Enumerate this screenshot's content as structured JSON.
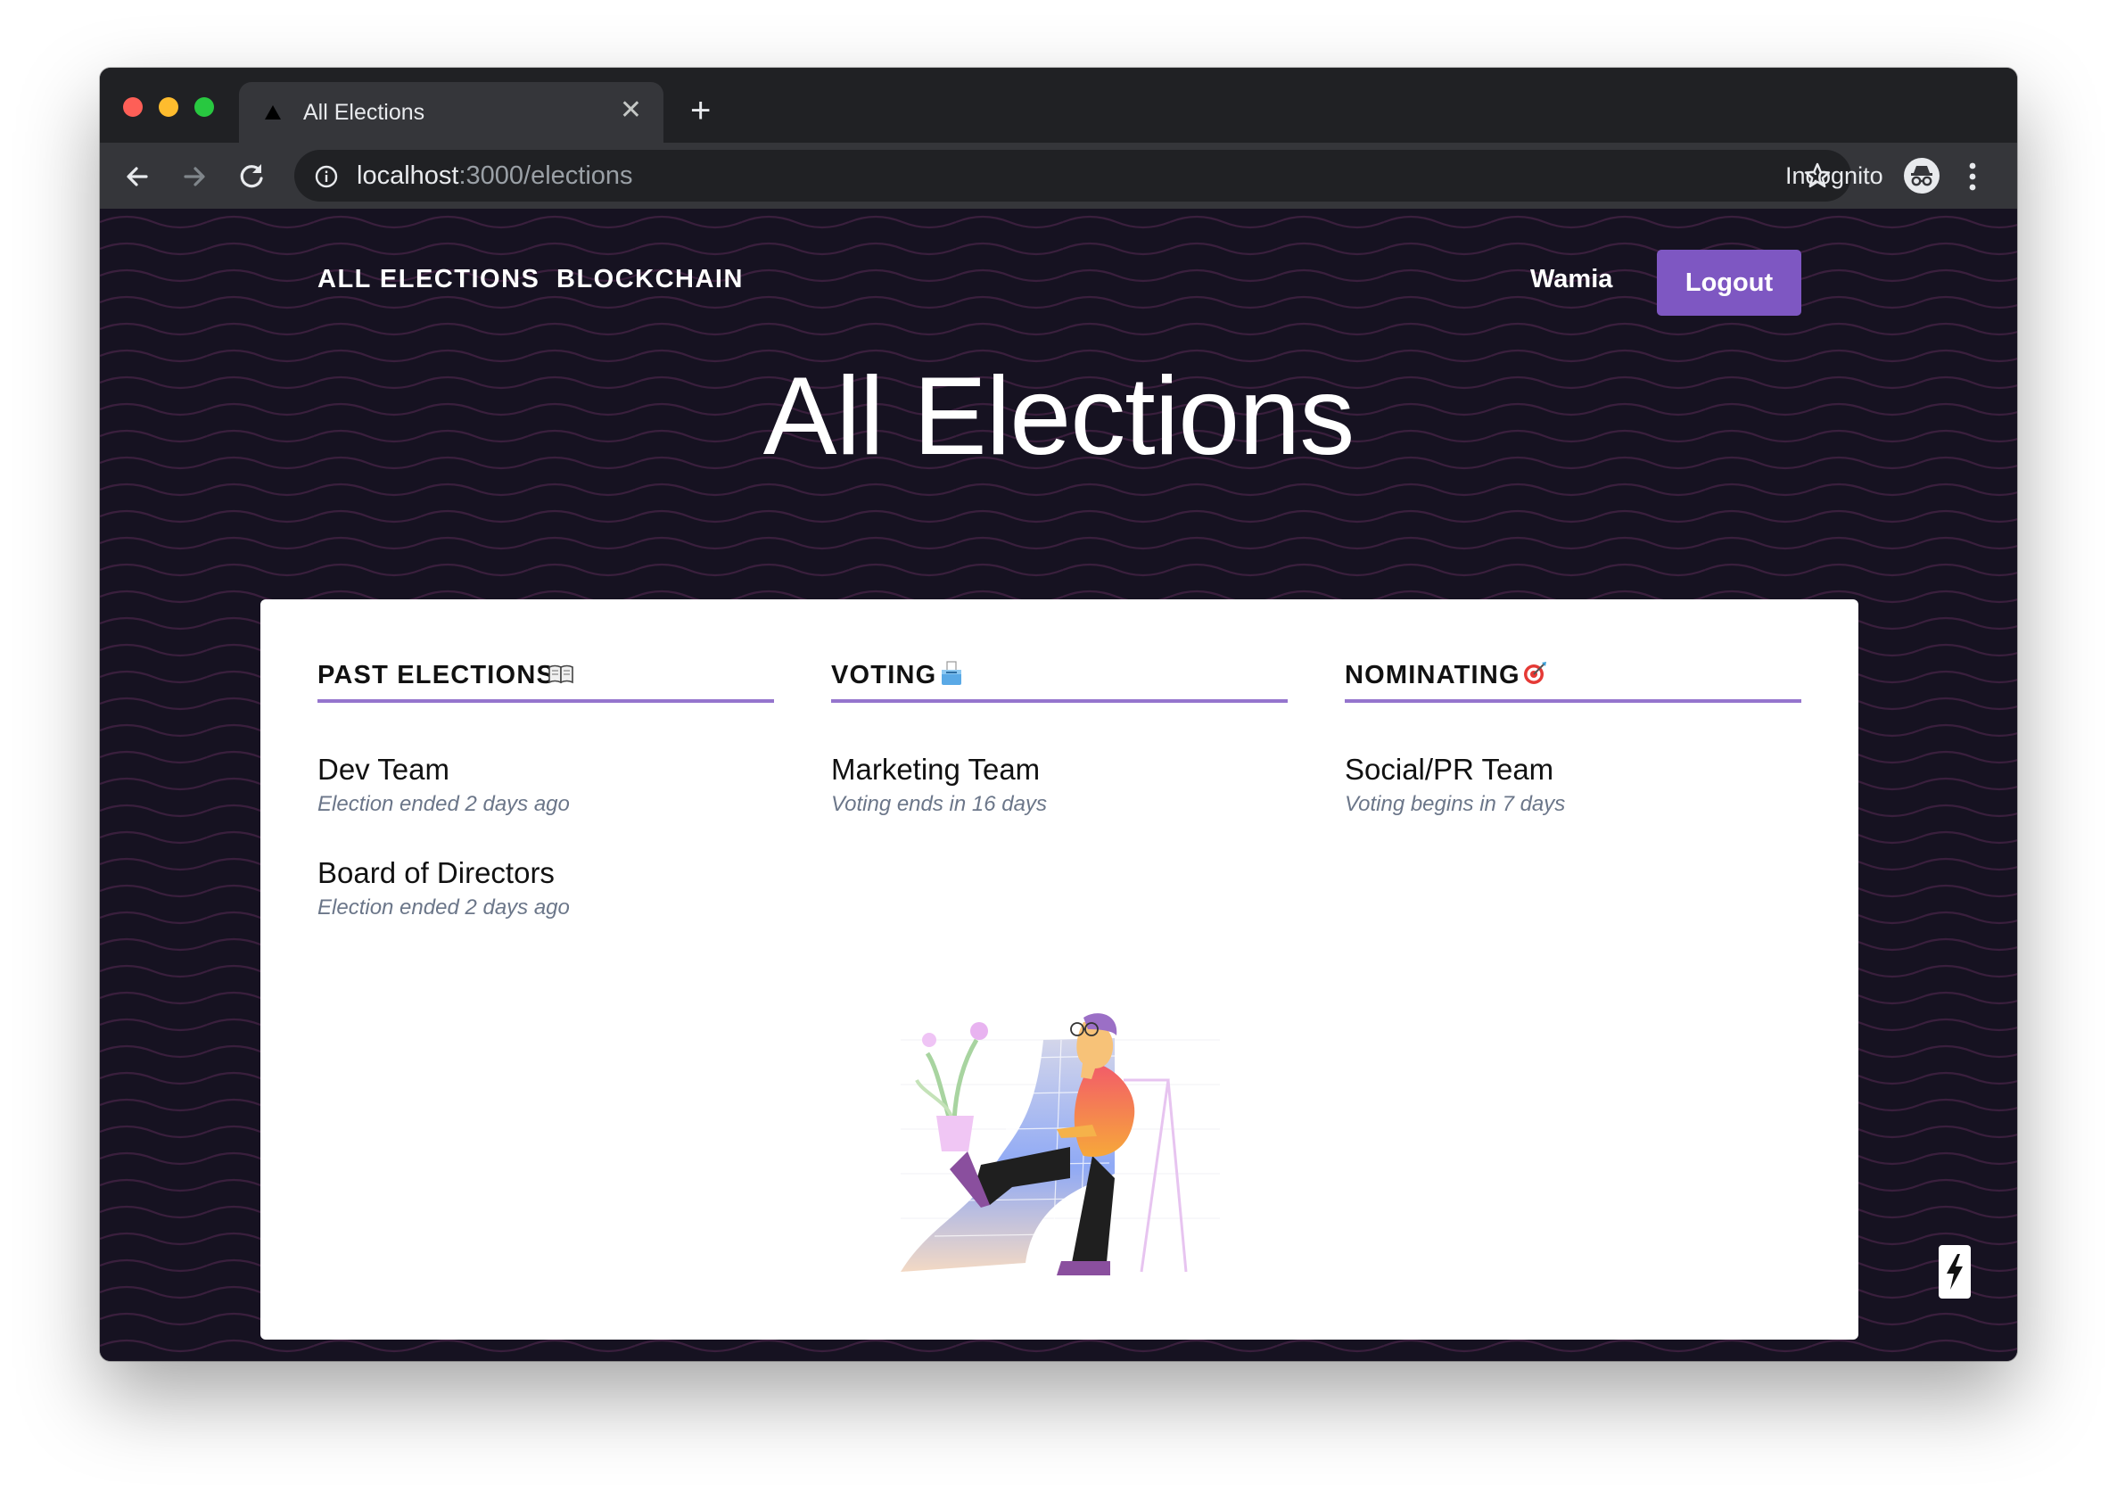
{
  "browser": {
    "tab_title": "All Elections",
    "close_glyph": "✕",
    "new_tab_glyph": "+",
    "url_host": "localhost",
    "url_rest": ":3000/elections",
    "incognito_label": "Incognito"
  },
  "nav": {
    "links": [
      "ALL ELECTIONS",
      "BLOCKCHAIN"
    ],
    "user_name": "Wamia",
    "logout_label": "Logout"
  },
  "page": {
    "title": "All Elections"
  },
  "columns": [
    {
      "title": "PAST ELECTIONS",
      "icon": "book-icon",
      "items": [
        {
          "name": "Dev Team",
          "status": "Election ended 2 days ago"
        },
        {
          "name": "Board of Directors",
          "status": "Election ended 2 days ago"
        }
      ]
    },
    {
      "title": "VOTING",
      "icon": "ballot-box-icon",
      "items": [
        {
          "name": "Marketing Team",
          "status": "Voting ends in 16 days"
        }
      ]
    },
    {
      "title": "NOMINATING",
      "icon": "target-icon",
      "items": [
        {
          "name": "Social/PR Team",
          "status": "Voting begins in 7 days"
        }
      ]
    }
  ],
  "colors": {
    "accent": "#7e57c2",
    "underline": "#9575cd",
    "background": "#161221",
    "wave": "#3a1f3d"
  }
}
